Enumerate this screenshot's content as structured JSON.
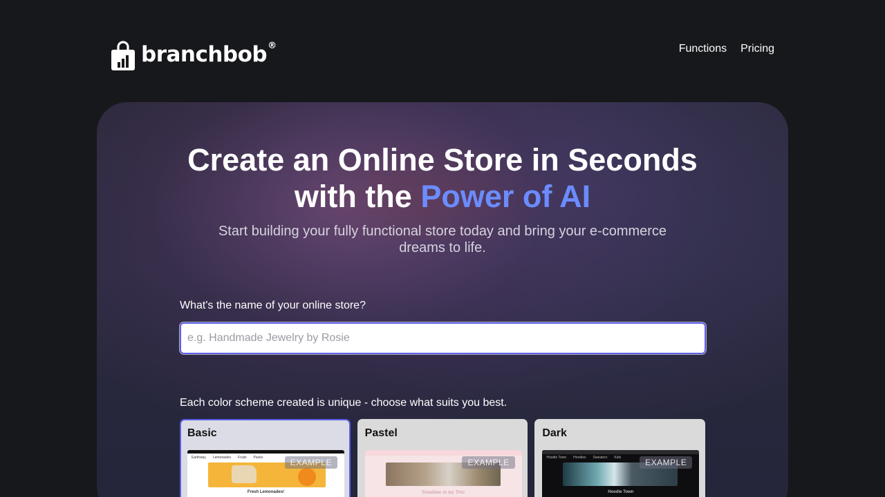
{
  "brand": {
    "name": "branchbob",
    "reg": "®"
  },
  "nav": {
    "functions": "Functions",
    "pricing": "Pricing"
  },
  "hero": {
    "title_line1": "Create an Online Store in Seconds",
    "title_line2_prefix": "with the ",
    "title_line2_accent": "Power of AI",
    "subtitle": "Start building your fully functional store today and bring your e-commerce dreams to life.",
    "accent_color": "#6b8cff"
  },
  "store_name": {
    "label": "What's the name of your online store?",
    "value": "",
    "placeholder": "e.g. Handmade Jewelry by Rosie"
  },
  "color_scheme": {
    "label": "Each color scheme created is unique - choose what suits you best.",
    "selected": "Basic",
    "options": [
      {
        "name": "Basic",
        "badge": "EXAMPLE",
        "preview_caption": "Fresh Lemonades!",
        "preview_nav": [
          "Earthway",
          "Lemonades",
          "Fruits",
          "Packs"
        ]
      },
      {
        "name": "Pastel",
        "badge": "EXAMPLE",
        "preview_caption": "Sunshine in my Tote"
      },
      {
        "name": "Dark",
        "badge": "EXAMPLE",
        "preview_caption": "Hoodie Town",
        "preview_nav": [
          "Hoodie Town",
          "Hoodies",
          "Sweaters",
          "Kids"
        ]
      }
    ]
  }
}
